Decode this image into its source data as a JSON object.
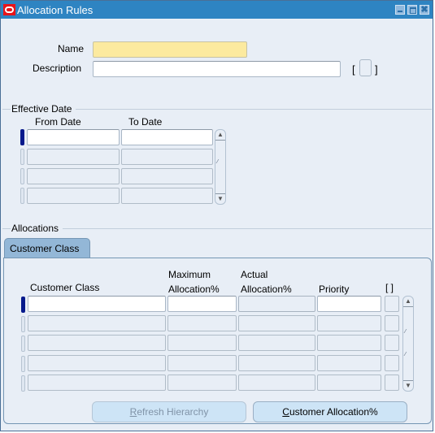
{
  "window": {
    "title": "Allocation Rules",
    "icon": "oracle-logo-icon",
    "controls": [
      "minimize-icon",
      "maximize-icon",
      "close-icon"
    ],
    "close_glyph": "✖"
  },
  "header": {
    "name_label": "Name",
    "name_value": "",
    "description_label": "Description",
    "description_value": "",
    "flex_bracket_open": "[",
    "flex_bracket_close": "]"
  },
  "effective_date": {
    "section_label": "Effective Date",
    "columns": [
      "From Date",
      "To Date"
    ],
    "rows": [
      {
        "from_date": "",
        "to_date": ""
      },
      {
        "from_date": "",
        "to_date": ""
      },
      {
        "from_date": "",
        "to_date": ""
      },
      {
        "from_date": "",
        "to_date": ""
      }
    ]
  },
  "allocations": {
    "section_label": "Allocations",
    "tabs": [
      {
        "label": "Customer Class",
        "active": true
      }
    ],
    "columns": {
      "customer_class": "Customer Class",
      "max_allocation_line1": "Maximum",
      "max_allocation_line2": "Allocation%",
      "actual_allocation_line1": "Actual",
      "actual_allocation_line2": "Allocation%",
      "priority": "Priority",
      "flex": "[ ]"
    },
    "rows": [
      {
        "customer_class": "",
        "max_allocation": "",
        "actual_allocation": "",
        "priority": ""
      },
      {
        "customer_class": "",
        "max_allocation": "",
        "actual_allocation": "",
        "priority": ""
      },
      {
        "customer_class": "",
        "max_allocation": "",
        "actual_allocation": "",
        "priority": ""
      },
      {
        "customer_class": "",
        "max_allocation": "",
        "actual_allocation": "",
        "priority": ""
      },
      {
        "customer_class": "",
        "max_allocation": "",
        "actual_allocation": "",
        "priority": ""
      }
    ]
  },
  "buttons": {
    "refresh_hierarchy": {
      "mnemonic": "R",
      "rest": "efresh Hierarchy",
      "enabled": false
    },
    "customer_allocation": {
      "mnemonic": "C",
      "rest": "ustomer Allocation%",
      "enabled": true
    }
  },
  "scroll": {
    "up_glyph": "▲",
    "down_glyph": "▼",
    "grip_glyph": "⁄⁄"
  }
}
